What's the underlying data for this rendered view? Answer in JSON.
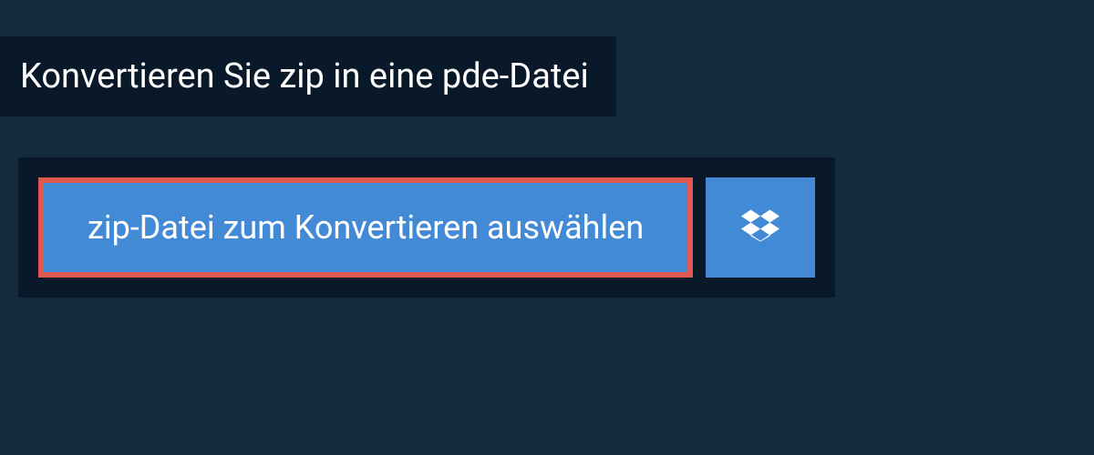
{
  "header": {
    "title": "Konvertieren Sie zip in eine pde-Datei"
  },
  "upload": {
    "select_file_label": "zip-Datei zum Konvertieren auswählen"
  }
}
